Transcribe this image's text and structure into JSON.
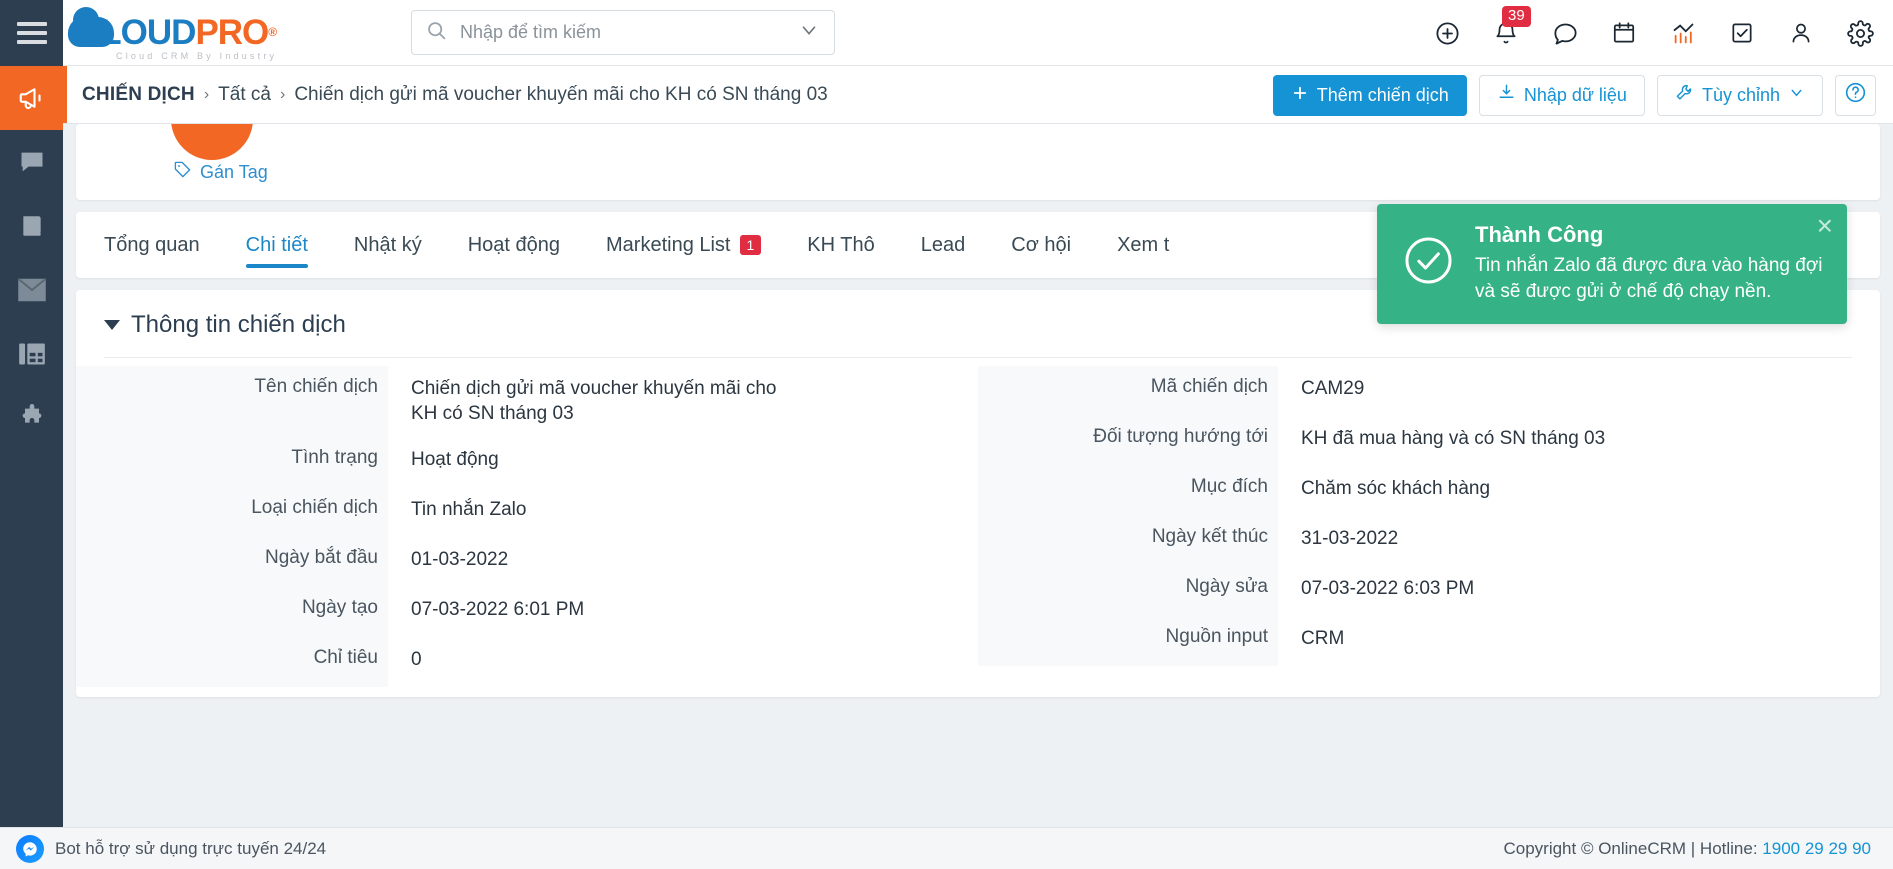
{
  "brand": {
    "name_blue": "CLOUD",
    "name_orange": "PRO",
    "registered": "®",
    "tagline": "Cloud CRM By Industry"
  },
  "search": {
    "placeholder": "Nhập để tìm kiếm"
  },
  "header": {
    "notification_count": "39",
    "icons": [
      "add-circle-icon",
      "bell-icon",
      "chat-icon",
      "calendar-icon",
      "analytics-icon",
      "task-icon",
      "user-icon",
      "gear-icon"
    ]
  },
  "sidebar": {
    "items": [
      {
        "name": "megaphone-icon",
        "active": true
      },
      {
        "name": "chat-bubble-icon",
        "active": false
      },
      {
        "name": "book-icon",
        "active": false
      },
      {
        "name": "mail-icon",
        "active": false
      },
      {
        "name": "news-icon",
        "active": false
      },
      {
        "name": "puzzle-icon",
        "active": false
      }
    ]
  },
  "breadcrumb": {
    "root": "CHIẾN DỊCH",
    "sep": "›",
    "level2": "Tất cả",
    "current": "Chiến dịch gửi mã voucher khuyến mãi cho KH có SN tháng 03"
  },
  "actions": {
    "add": "Thêm chiến dịch",
    "import": "Nhập dữ liệu",
    "customize": "Tùy chỉnh",
    "help": "?"
  },
  "record": {
    "tag_label": "Gán Tag"
  },
  "tabs": [
    {
      "label": "Tổng quan",
      "active": false,
      "badge": ""
    },
    {
      "label": "Chi tiết",
      "active": true,
      "badge": ""
    },
    {
      "label": "Nhật ký",
      "active": false,
      "badge": ""
    },
    {
      "label": "Hoạt động",
      "active": false,
      "badge": ""
    },
    {
      "label": "Marketing List",
      "active": false,
      "badge": "1"
    },
    {
      "label": "KH Thô",
      "active": false,
      "badge": ""
    },
    {
      "label": "Lead",
      "active": false,
      "badge": ""
    },
    {
      "label": "Cơ hội",
      "active": false,
      "badge": ""
    },
    {
      "label": "Xem t",
      "active": false,
      "badge": ""
    }
  ],
  "section": {
    "title": "Thông tin chiến dịch"
  },
  "fields_left": [
    {
      "label": "Tên chiến dịch",
      "value": "Chiến dịch gửi mã voucher khuyến mãi cho KH có SN tháng 03"
    },
    {
      "label": "Tình trạng",
      "value": "Hoạt động"
    },
    {
      "label": "Loại chiến dịch",
      "value": "Tin nhắn Zalo"
    },
    {
      "label": "Ngày bắt đầu",
      "value": "01-03-2022"
    },
    {
      "label": "Ngày tạo",
      "value": "07-03-2022 6:01 PM"
    },
    {
      "label": "Chỉ tiêu",
      "value": "0"
    }
  ],
  "fields_right": [
    {
      "label": "Mã chiến dịch",
      "value": "CAM29"
    },
    {
      "label": "Đối tượng hướng tới",
      "value": "KH đã mua hàng và có SN tháng 03"
    },
    {
      "label": "Mục đích",
      "value": "Chăm sóc khách hàng"
    },
    {
      "label": "Ngày kết thúc",
      "value": "31-03-2022"
    },
    {
      "label": "Ngày sửa",
      "value": "07-03-2022 6:03 PM"
    },
    {
      "label": "Nguồn input",
      "value": "CRM"
    }
  ],
  "toast": {
    "title": "Thành Công",
    "message": "Tin nhắn Zalo đã được đưa vào hàng đợi và sẽ được gửi ở chế độ chạy nền.",
    "close": "×",
    "color": "#35b387"
  },
  "footer": {
    "left": "Bot hỗ trợ sử dụng trực tuyến 24/24",
    "copyright": "Copyright © OnlineCRM | Hotline: ",
    "hotline": "1900 29 29 90"
  },
  "colors": {
    "accent_blue": "#1693d4",
    "accent_orange": "#f26724",
    "rail_dark": "#2c3e50",
    "success_green": "#35b387",
    "badge_red": "#e02d42"
  }
}
